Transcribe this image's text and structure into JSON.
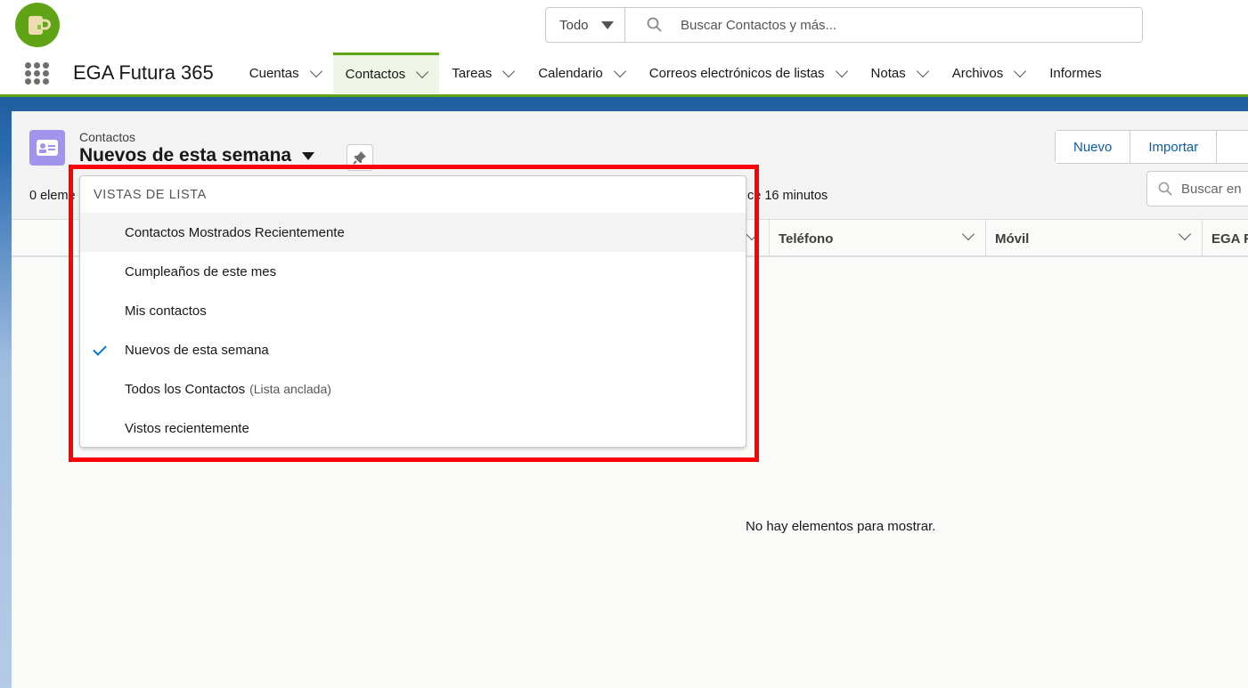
{
  "header": {
    "search_scope": "Todo",
    "search_placeholder": "Buscar Contactos y más..."
  },
  "nav": {
    "app_name": "EGA Futura 365",
    "tabs": [
      {
        "label": "Cuentas"
      },
      {
        "label": "Contactos",
        "active": true
      },
      {
        "label": "Tareas"
      },
      {
        "label": "Calendario"
      },
      {
        "label": "Correos electrónicos de listas"
      },
      {
        "label": "Notas"
      },
      {
        "label": "Archivos"
      },
      {
        "label": "Informes"
      }
    ]
  },
  "list": {
    "object_label": "Contactos",
    "view_title": "Nuevos de esta semana",
    "status_left": "0 eleme",
    "status_right": "ce 16 minutos",
    "buttons": {
      "new": "Nuevo",
      "import": "Importar"
    },
    "search_placeholder": "Buscar en",
    "columns": [
      "Teléfono",
      "Móvil",
      "EGA F"
    ],
    "empty_message": "No hay elementos para mostrar."
  },
  "dropdown": {
    "header": "VISTAS DE LISTA",
    "items": [
      {
        "label": "Contactos Mostrados Recientemente"
      },
      {
        "label": "Cumpleaños de este mes"
      },
      {
        "label": "Mis contactos"
      },
      {
        "label": "Nuevos de esta semana",
        "selected": true
      },
      {
        "label": "Todos los Contactos",
        "sub": "(Lista anclada)"
      },
      {
        "label": "Vistos recientemente"
      }
    ]
  },
  "colors": {
    "brand_green": "#5ea414",
    "highlight": "#ff0000",
    "check": "#0176d3"
  }
}
